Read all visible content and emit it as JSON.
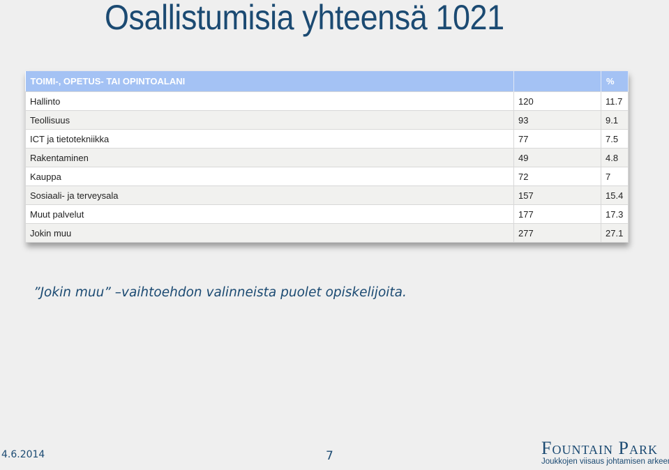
{
  "title": "Osallistumisia yhteensä 1021",
  "table": {
    "headers": [
      "TOIMI-, OPETUS- TAI OPINTOALANI",
      "",
      "%"
    ],
    "rows": [
      {
        "label": "Hallinto",
        "count": "120",
        "percent": "11.7"
      },
      {
        "label": "Teollisuus",
        "count": "93",
        "percent": "9.1"
      },
      {
        "label": "ICT ja tietotekniikka",
        "count": "77",
        "percent": "7.5"
      },
      {
        "label": "Rakentaminen",
        "count": "49",
        "percent": "4.8"
      },
      {
        "label": "Kauppa",
        "count": "72",
        "percent": "7"
      },
      {
        "label": "Sosiaali- ja terveysala",
        "count": "157",
        "percent": "15.4"
      },
      {
        "label": "Muut palvelut",
        "count": "177",
        "percent": "17.3"
      },
      {
        "label": "Jokin muu",
        "count": "277",
        "percent": "27.1"
      }
    ]
  },
  "note": "”Jokin muu” –vaihtoehdon valinneista puolet opiskelijoita.",
  "footer": {
    "date": "4.6.2014",
    "page_number": "7",
    "logo_main": "Fountain Park",
    "logo_sub": "Joukkojen viisaus johtamisen arkeen"
  },
  "colors": {
    "accent": "#1b4a72",
    "table_header": "#a4c2f4"
  }
}
